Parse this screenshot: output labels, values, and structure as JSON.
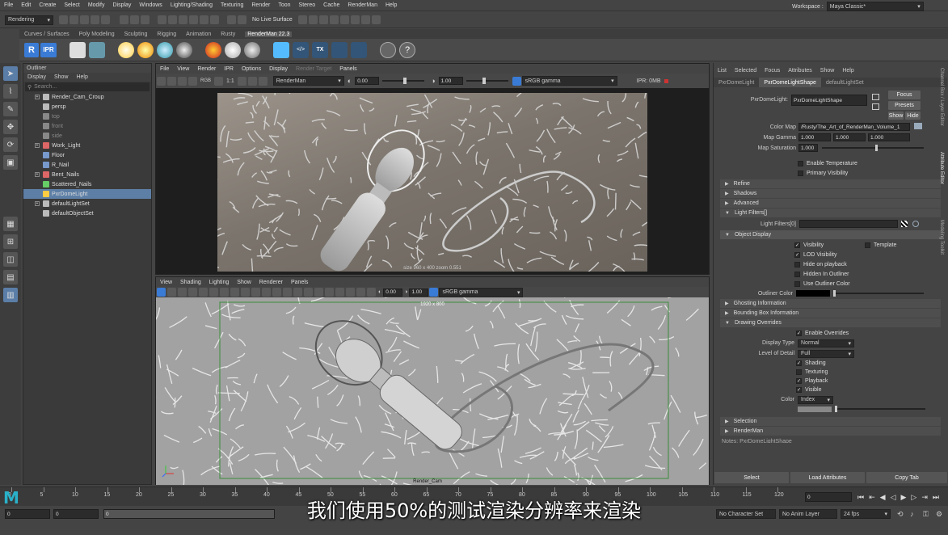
{
  "menu": [
    "File",
    "Edit",
    "Create",
    "Select",
    "Modify",
    "Display",
    "Windows",
    "Lighting/Shading",
    "Texturing",
    "Render",
    "Toon",
    "Stereo",
    "Cache",
    "RenderMan",
    "Help"
  ],
  "workspace": {
    "label": "Workspace :",
    "value": "Maya Classic*"
  },
  "mode_select": "Rendering",
  "live_surface": "No Live Surface",
  "shelf_tabs": [
    "Curves / Surfaces",
    "Poly Modeling",
    "Sculpting",
    "Rigging",
    "Animation",
    "Rusty",
    "RenderMan 22.3"
  ],
  "active_shelf": "RenderMan 22.3",
  "shelf_buttons": {
    "r_label": "R",
    "ipr_label": "IPR",
    "tx_label": "TX"
  },
  "outliner": {
    "title": "Outliner",
    "menu": [
      "Display",
      "Show",
      "Help"
    ],
    "search_placeholder": "Search...",
    "items": [
      {
        "name": "Render_Cam_Croup",
        "expand": "+",
        "color": "#bbb"
      },
      {
        "name": "persp",
        "expand": "",
        "color": "#bbb"
      },
      {
        "name": "top",
        "expand": "",
        "color": "#888",
        "dim": true
      },
      {
        "name": "front",
        "expand": "",
        "color": "#888",
        "dim": true
      },
      {
        "name": "side",
        "expand": "",
        "color": "#888",
        "dim": true
      },
      {
        "name": "Work_Light",
        "expand": "+",
        "color": "#d66"
      },
      {
        "name": "Floor",
        "expand": "",
        "color": "#79c"
      },
      {
        "name": "R_Nail",
        "expand": "",
        "color": "#79c"
      },
      {
        "name": "Bent_Nails",
        "expand": "+",
        "color": "#d66"
      },
      {
        "name": "Scattered_Nails",
        "expand": "",
        "color": "#6c6"
      },
      {
        "name": "PxrDomeLight",
        "expand": "",
        "color": "#fc4",
        "selected": true
      },
      {
        "name": "defaultLightSet",
        "expand": "+",
        "color": "#bbb"
      },
      {
        "name": "defaultObjectSet",
        "expand": "",
        "color": "#bbb"
      }
    ]
  },
  "render_view": {
    "menu": [
      "File",
      "View",
      "Render",
      "IPR",
      "Options",
      "Display",
      "Render Target",
      "Panels"
    ],
    "renderer": "RenderMan",
    "exposure": "0.00",
    "gamma": "1.00",
    "colorspace": "sRGB gamma",
    "ipr": "IPR: 0MB",
    "rgb": "RGB",
    "ratio": "1:1",
    "caption": "size 960 x 400  zoom 0.551"
  },
  "viewport": {
    "menu": [
      "View",
      "Shading",
      "Lighting",
      "Show",
      "Renderer",
      "Panels"
    ],
    "exposure": "0.00",
    "gamma": "1.00",
    "colorspace": "sRGB gamma",
    "resolution": "1920 x 800",
    "camera": "Render_Cam"
  },
  "attr": {
    "menu": [
      "List",
      "Selected",
      "Focus",
      "Attributes",
      "Show",
      "Help"
    ],
    "tabs": [
      "PxrDomeLight",
      "PxrDomeLightShape",
      "defaultLightSet"
    ],
    "active_tab": "PxrDomeLightShape",
    "node_label": "PxrDomeLight:",
    "node_value": "PxrDomeLightShape",
    "focus": "Focus",
    "presets": "Presets",
    "show": "Show",
    "hide": "Hide",
    "color_map_label": "Color Map",
    "color_map_value": "/Rusty/The_Art_of_RenderMan_Volume_1",
    "map_gamma_label": "Map Gamma",
    "map_gamma": [
      "1.000",
      "1.000",
      "1.000"
    ],
    "map_saturation_label": "Map Saturation",
    "map_saturation": "1.000",
    "enable_temperature": "Enable Temperature",
    "primary_visibility": "Primary Visibility",
    "sections1": [
      "Refine",
      "Shadows",
      "Advanced"
    ],
    "light_filters_section": "Light Filters[]",
    "light_filters_label": "Light Filters[0]",
    "object_display": "Object Display",
    "visibility": "Visibility",
    "template": "Template",
    "lod_visibility": "LOD Visibility",
    "hide_on_playback": "Hide on playback",
    "hidden_in_outliner": "Hidden In Outliner",
    "use_outliner_color": "Use Outliner Color",
    "outliner_color_label": "Outliner Color",
    "sections2": [
      "Ghosting Information",
      "Bounding Box Information"
    ],
    "drawing_overrides": "Drawing Overrides",
    "enable_overrides": "Enable Overrides",
    "display_type_label": "Display Type",
    "display_type": "Normal",
    "lod_label": "Level of Detail",
    "lod": "Full",
    "shading": "Shading",
    "texturing": "Texturing",
    "playback": "Playback",
    "visible": "Visible",
    "color_label": "Color",
    "color_value": "Index",
    "sections3": [
      "Selection",
      "RenderMan"
    ],
    "notes": "Notes: PxrDomeLightShape",
    "btn_select": "Select",
    "btn_load": "Load Attributes",
    "btn_copy": "Copy Tab"
  },
  "side_tabs": [
    "Channel Box / Layer Editor",
    "Attribute Editor",
    "Modeling Toolkit"
  ],
  "timeline": {
    "ticks": [
      "0",
      "5",
      "10",
      "15",
      "20",
      "25",
      "30",
      "35",
      "40",
      "45",
      "50",
      "55",
      "60",
      "65",
      "70",
      "75",
      "80",
      "85",
      "90",
      "95",
      "100",
      "105",
      "110",
      "115",
      "120"
    ],
    "current": "0"
  },
  "range": {
    "start": "0",
    "start2": "0",
    "slider_val": "0",
    "char_set": "No Character Set",
    "anim_layer": "No Anim Layer",
    "fps": "24 fps"
  },
  "subtitle": "我们使用50%的测试渲染分辨率来渲染"
}
